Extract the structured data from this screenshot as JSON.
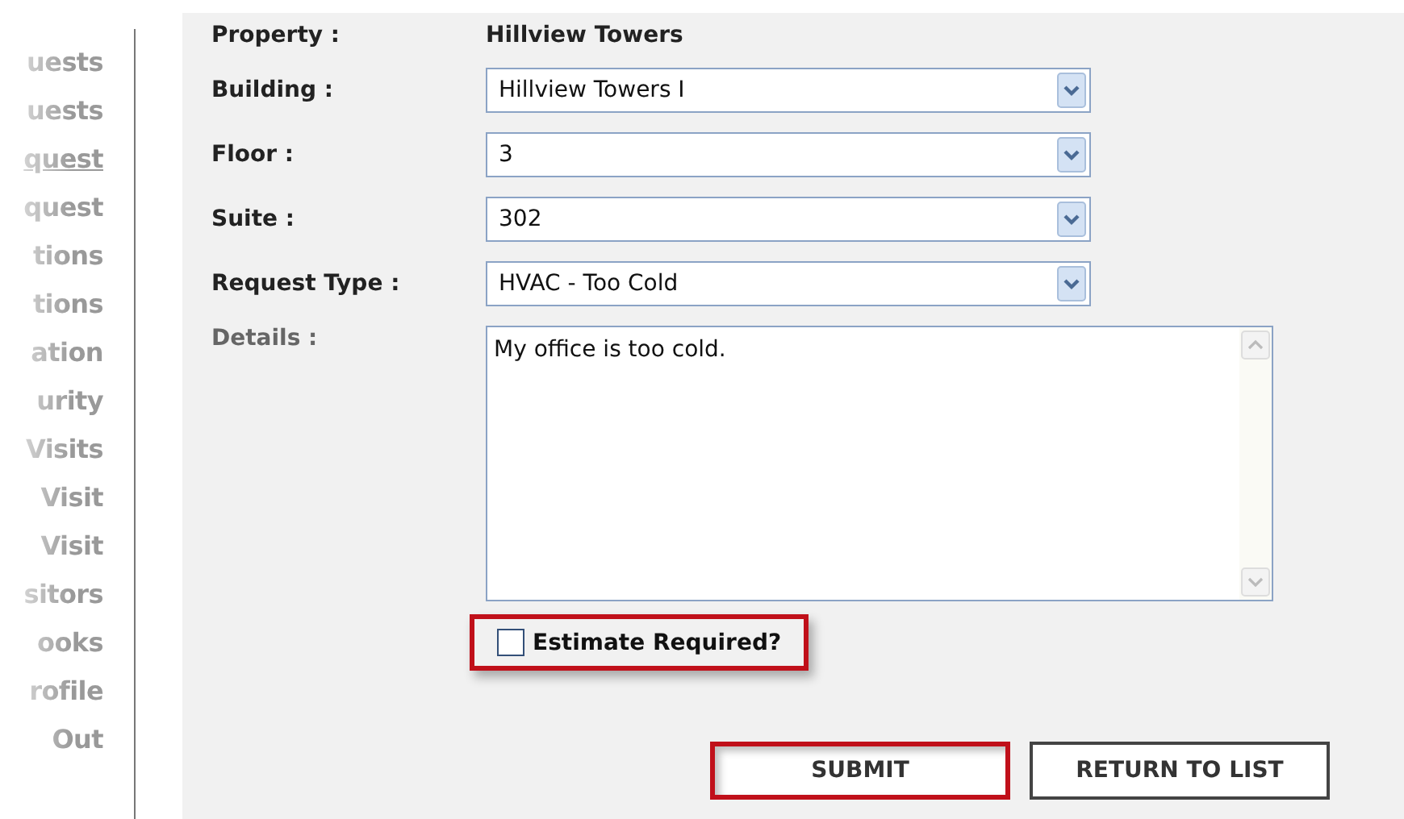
{
  "sidebar": {
    "items": [
      {
        "label": "uests",
        "selected": false
      },
      {
        "label": "uests",
        "selected": false
      },
      {
        "label": "quest",
        "selected": true
      },
      {
        "label": "quest",
        "selected": false
      },
      {
        "label": "tions",
        "selected": false
      },
      {
        "label": "tions",
        "selected": false
      },
      {
        "label": "ation",
        "selected": false
      },
      {
        "label": "urity",
        "selected": false
      },
      {
        "label": "Visits",
        "selected": false
      },
      {
        "label": "Visit",
        "selected": false
      },
      {
        "label": "Visit",
        "selected": false
      },
      {
        "label": "sitors",
        "selected": false
      },
      {
        "label": "ooks",
        "selected": false
      },
      {
        "label": "rofile",
        "selected": false
      },
      {
        "label": "Out",
        "selected": false
      }
    ]
  },
  "form": {
    "fields": [
      {
        "kind": "text",
        "label": "Property :",
        "value": "Hillview Towers"
      },
      {
        "kind": "select",
        "label": "Building :",
        "value": "Hillview Towers I"
      },
      {
        "kind": "select",
        "label": "Floor :",
        "value": "3"
      },
      {
        "kind": "select",
        "label": "Suite :",
        "value": "302"
      },
      {
        "kind": "select",
        "label": "Request Type :",
        "value": "HVAC - Too Cold"
      },
      {
        "kind": "textarea",
        "label": "Details :",
        "value": "My office is too cold."
      }
    ],
    "checkbox": {
      "label": "Estimate Required?",
      "checked": false,
      "highlighted": true
    },
    "buttons": [
      {
        "label": "SUBMIT",
        "highlighted": true
      },
      {
        "label": "RETURN TO LIST",
        "highlighted": false
      }
    ]
  }
}
